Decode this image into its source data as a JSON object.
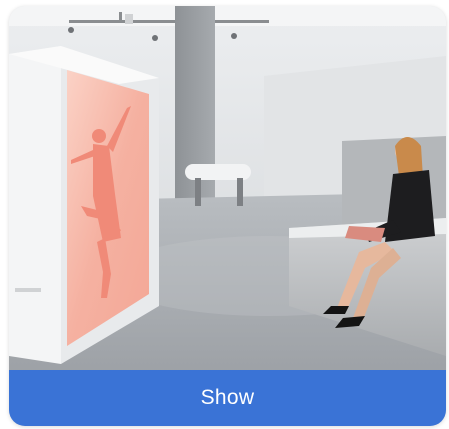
{
  "card": {
    "image_name": "display-cabinet-showroom-photo",
    "show_label": "Show"
  },
  "colors": {
    "button_bg": "#3a73d6",
    "button_text": "#ffffff",
    "screen_glow": "#f7b3a3"
  }
}
